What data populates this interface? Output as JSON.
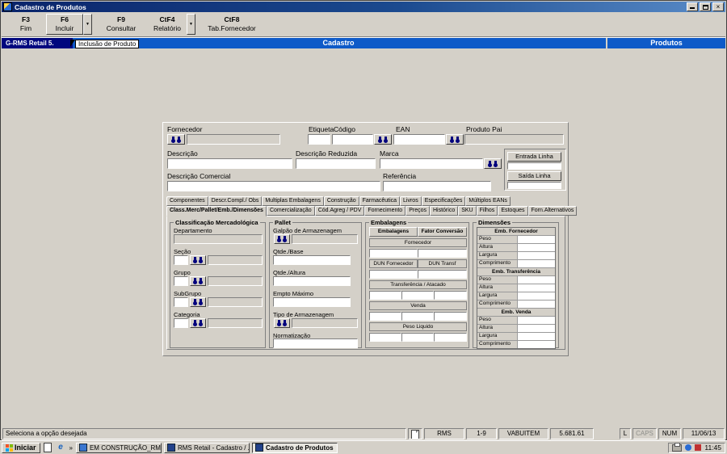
{
  "window": {
    "title": "Cadastro de Produtos"
  },
  "icons": {
    "close": "×",
    "dropdown": "▼",
    "overflow": "»",
    "ie": "e"
  },
  "toolbar": {
    "buttons": [
      {
        "key": "F3",
        "label": "Fim"
      },
      {
        "key": "F6",
        "label": "Incluir"
      },
      {
        "key": "F9",
        "label": "Consultar"
      },
      {
        "key": "CtF4",
        "label": "Relatório"
      },
      {
        "key": "CtF8",
        "label": "Tab.Fornecedor"
      }
    ]
  },
  "banner": {
    "app": "G-RMS Retail 5.",
    "tooltip": "Inclusão de Produto",
    "center": "Cadastro",
    "right": "Produtos"
  },
  "form": {
    "fornecedor": "Fornecedor",
    "etiqueta": "Etiqueta",
    "codigo": "Código",
    "ean": "EAN",
    "produto_pai": "Produto Pai",
    "descricao": "Descrição",
    "descricao_reduzida": "Descrição Reduzida",
    "marca": "Marca",
    "descricao_comercial": "Descrição Comercial",
    "referencia": "Referência",
    "entrada_linha": "Entrada Linha",
    "saida_linha": "Saída Linha"
  },
  "tabs": {
    "row1": [
      "Componentes",
      "Descr.Compl./ Obs",
      "Multiplas Embalagens",
      "Construção",
      "Farmacêutica",
      "Livros",
      "Especificações",
      "Múltiplos EANs"
    ],
    "row2": [
      "Class.Merc/Pallet/Emb./Dimensões",
      "Comercialização",
      "Cód.Agreg / PDV",
      "Fornecimento",
      "Preços",
      "Histórico",
      "SKU",
      "Filhos",
      "Estoques",
      "Forn.Alternativos"
    ]
  },
  "class_merc": {
    "title": "Classificação Mercadológica",
    "departamento": "Departamento",
    "secao": "Seção",
    "grupo": "Grupo",
    "subgrupo": "SubGrupo",
    "categoria": "Categoria"
  },
  "pallet": {
    "title": "Pallet",
    "galpao": "Galpão de Armazenagem",
    "qtde_base": "Qtde./Base",
    "qtde_altura": "Qtde./Altura",
    "empto_maximo": "Empto Máximo",
    "tipo_armazenagem": "Tipo de Armazenagem",
    "normatizacao": "Normatização"
  },
  "embalagens": {
    "title": "Embalagens",
    "col_embalagens": "Embalagens",
    "col_fator": "Fator Conversão",
    "sec_fornecedor": "Fornecedor",
    "dun_fornecedor": "DUN Fornecedor",
    "dun_transf": "DUN Transf",
    "sec_transferencia": "Transferência / Atacado",
    "sec_venda": "Venda",
    "sec_peso": "Peso Liquido"
  },
  "dimensoes": {
    "title": "Dimensões",
    "sections": [
      {
        "header": "Emb. Fornecedor",
        "rows": [
          "Peso",
          "Altura",
          "Largura",
          "Comprimento"
        ]
      },
      {
        "header": "Emb. Transferência",
        "rows": [
          "Peso",
          "Altura",
          "Largura",
          "Comprimento"
        ]
      },
      {
        "header": "Emb. Venda",
        "rows": [
          "Peso",
          "Altura",
          "Largura",
          "Comprimento"
        ]
      }
    ]
  },
  "statusbar": {
    "message": "Seleciona a opção desejada",
    "rms": "RMS",
    "range": "1-9",
    "program": "VABUITEM",
    "version": "5.681.61",
    "flag_l": "L",
    "flag_caps": "CAPS",
    "flag_num": "NUM",
    "date": "11/06/13"
  },
  "taskbar": {
    "start": "Iniciar",
    "tasks": [
      "EM CONSTRUÇÃO_RMS ...",
      "RMS Retail - Cadastro / ...",
      "Cadastro de Produtos"
    ],
    "clock": "11:45"
  },
  "colors": {
    "banner_blue": "#0e5ac8",
    "banner_navy": "#00077e",
    "chrome_gray": "#d4d0c8"
  }
}
